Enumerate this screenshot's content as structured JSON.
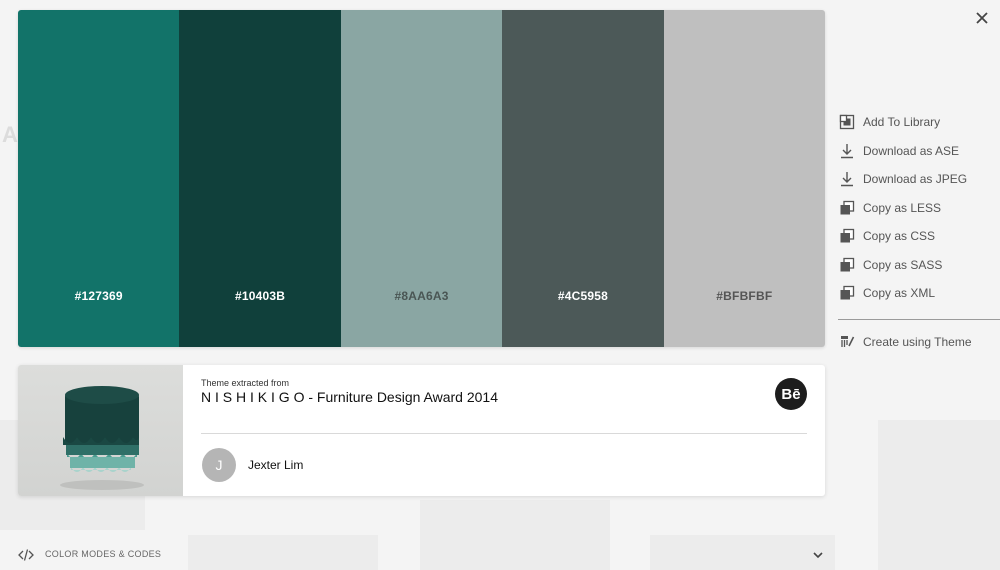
{
  "close": {
    "icon": "close-icon"
  },
  "palette": {
    "swatches": [
      {
        "hex": "#127369",
        "label": "#127369",
        "text_color": "#ffffff"
      },
      {
        "hex": "#10403B",
        "label": "#10403B",
        "text_color": "#ffffff"
      },
      {
        "hex": "#8AA6A3",
        "label": "#8AA6A3",
        "text_color": "#4a5654"
      },
      {
        "hex": "#4C5958",
        "label": "#4C5958",
        "text_color": "#ffffff"
      },
      {
        "hex": "#BFBFBF",
        "label": "#BFBFBF",
        "text_color": "#555555"
      }
    ]
  },
  "actions": {
    "add_library": {
      "label": "Add To Library",
      "icon": "library-icon"
    },
    "download_ase": {
      "label": "Download as ASE",
      "icon": "download-icon"
    },
    "download_jpeg": {
      "label": "Download as JPEG",
      "icon": "download-icon"
    },
    "copy_less": {
      "label": "Copy as LESS",
      "icon": "copy-icon"
    },
    "copy_css": {
      "label": "Copy as CSS",
      "icon": "copy-icon"
    },
    "copy_sass": {
      "label": "Copy as SASS",
      "icon": "copy-icon"
    },
    "copy_xml": {
      "label": "Copy as XML",
      "icon": "copy-icon"
    },
    "create_theme": {
      "label": "Create using Theme",
      "icon": "brush-icon"
    }
  },
  "source": {
    "extracted_label": "Theme extracted from",
    "title": "N I S H I K I G O - Furniture Design Award 2014",
    "behance_badge": "Bē",
    "author_initial": "J",
    "author": "Jexter Lim"
  },
  "footer": {
    "modes_label": "COLOR MODES & CODES"
  }
}
